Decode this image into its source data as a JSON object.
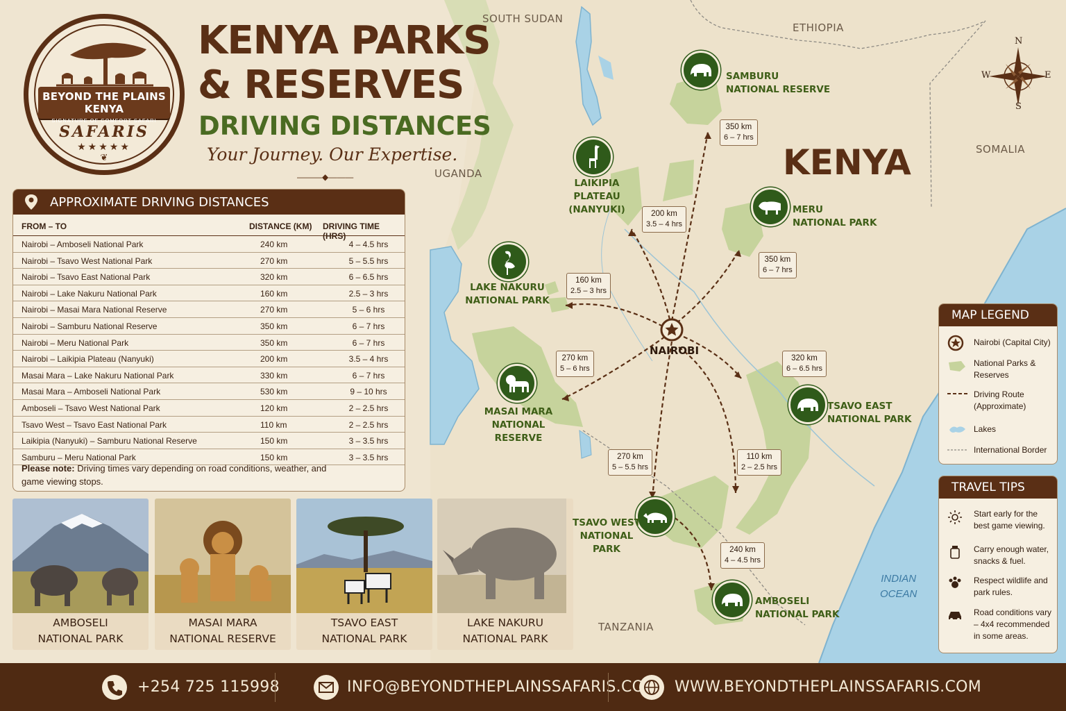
{
  "logo": {
    "brand": "BEYOND THE PLAINS KENYA",
    "subtitle": "SIGNATURE OF COMFORT SAFARI",
    "safaris": "SAFARIS",
    "stars": "★★★★★"
  },
  "title": {
    "line1": "KENYA PARKS",
    "line2": "& RESERVES",
    "line3": "DRIVING DISTANCES",
    "tagline": "Your Journey. Our Expertise."
  },
  "table": {
    "heading": "APPROXIMATE DRIVING DISTANCES",
    "columns": [
      "FROM – TO",
      "DISTANCE (KM)",
      "DRIVING TIME (HRS)"
    ],
    "rows": [
      [
        "Nairobi – Amboseli National Park",
        "240 km",
        "4 – 4.5 hrs"
      ],
      [
        "Nairobi – Tsavo West National Park",
        "270 km",
        "5 – 5.5 hrs"
      ],
      [
        "Nairobi – Tsavo East National Park",
        "320 km",
        "6 – 6.5 hrs"
      ],
      [
        "Nairobi – Lake Nakuru National Park",
        "160 km",
        "2.5 – 3 hrs"
      ],
      [
        "Nairobi – Masai Mara National Reserve",
        "270 km",
        "5 – 6 hrs"
      ],
      [
        "Nairobi – Samburu National Reserve",
        "350 km",
        "6 – 7 hrs"
      ],
      [
        "Nairobi – Meru National Park",
        "350 km",
        "6 – 7 hrs"
      ],
      [
        "Nairobi – Laikipia Plateau (Nanyuki)",
        "200 km",
        "3.5 – 4 hrs"
      ],
      [
        "Masai Mara – Lake Nakuru National Park",
        "330 km",
        "6 – 7 hrs"
      ],
      [
        "Masai Mara – Amboseli National Park",
        "530 km",
        "9 – 10 hrs"
      ],
      [
        "Amboseli – Tsavo West National Park",
        "120 km",
        "2 – 2.5 hrs"
      ],
      [
        "Tsavo West – Tsavo East National Park",
        "110 km",
        "2 – 2.5 hrs"
      ],
      [
        "Laikipia (Nanyuki) – Samburu National Reserve",
        "150 km",
        "3 – 3.5 hrs"
      ],
      [
        "Samburu – Meru National Park",
        "150 km",
        "3 – 3.5 hrs"
      ]
    ],
    "note_bold": "Please note:",
    "note_text": " Driving times vary depending on road conditions, weather, and game viewing stops."
  },
  "photos": [
    {
      "l1": "AMBOSELI",
      "l2": "NATIONAL PARK"
    },
    {
      "l1": "MASAI MARA",
      "l2": "NATIONAL RESERVE"
    },
    {
      "l1": "TSAVO EAST",
      "l2": "NATIONAL PARK"
    },
    {
      "l1": "LAKE NAKURU",
      "l2": "NATIONAL PARK"
    }
  ],
  "map": {
    "countries": {
      "south_sudan": "SOUTH SUDAN",
      "ethiopia": "ETHIOPIA",
      "uganda": "UGANDA",
      "somalia": "SOMALIA",
      "tanzania": "TANZANIA",
      "kenya": "KENYA",
      "ocean1": "INDIAN",
      "ocean2": "OCEAN"
    },
    "compass": {
      "n": "N",
      "s": "S",
      "e": "E",
      "w": "W"
    },
    "capital": "NAIROBI",
    "parks": {
      "samburu": [
        "SAMBURU",
        "NATIONAL RESERVE"
      ],
      "laikipia": [
        "LAIKIPIA PLATEAU",
        "(NANYUKI)"
      ],
      "meru": [
        "MERU",
        "NATIONAL PARK"
      ],
      "nakuru": [
        "LAKE NAKURU",
        "NATIONAL PARK"
      ],
      "mara": [
        "MASAI MARA",
        "NATIONAL RESERVE"
      ],
      "tsavo_east": [
        "TSAVO EAST",
        "NATIONAL PARK"
      ],
      "tsavo_west": [
        "TSAVO WEST",
        "NATIONAL PARK"
      ],
      "amboseli": [
        "AMBOSELI",
        "NATIONAL PARK"
      ]
    },
    "distances": {
      "samburu": [
        "350 km",
        "6 – 7 hrs"
      ],
      "laikipia": [
        "200 km",
        "3.5 – 4 hrs"
      ],
      "meru": [
        "350 km",
        "6 – 7 hrs"
      ],
      "nakuru": [
        "160 km",
        "2.5 – 3 hrs"
      ],
      "mara": [
        "270 km",
        "5 – 6 hrs"
      ],
      "tsavo_east": [
        "320 km",
        "6 – 6.5 hrs"
      ],
      "tsavo_west": [
        "270 km",
        "5 – 5.5 hrs"
      ],
      "tw_te": [
        "110 km",
        "2 – 2.5 hrs"
      ],
      "amboseli": [
        "240 km",
        "4 – 4.5 hrs"
      ]
    }
  },
  "legend": {
    "title": "MAP LEGEND",
    "items": [
      "Nairobi (Capital City)",
      "National Parks & Reserves",
      "Driving Route (Approximate)",
      "Lakes",
      "International Border"
    ]
  },
  "tips": {
    "title": "TRAVEL TIPS",
    "items": [
      "Start early for the best game viewing.",
      "Carry enough water, snacks & fuel.",
      "Respect wildlife and park rules.",
      "Road conditions vary – 4x4 recommended in some areas."
    ]
  },
  "footer": {
    "phone": "+254 725 115998",
    "email": "INFO@BEYONDTHEPLAINSSAFARIS.COM",
    "web": "WWW.BEYONDTHEPLAINSSAFARIS.COM"
  },
  "colors": {
    "brown": "#5a2f15",
    "green": "#4a6b22",
    "park_fill": "#c6d39c",
    "water": "#a9d2e6"
  }
}
